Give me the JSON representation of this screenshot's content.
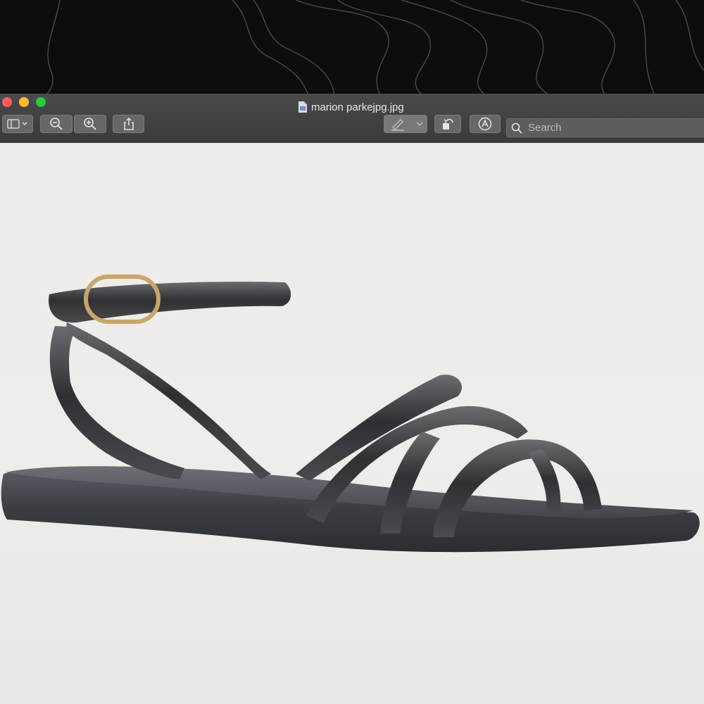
{
  "window": {
    "title": "marion parkejpg.jpg",
    "search_placeholder": "Search"
  },
  "toolbar": {
    "sidebar_icon": "sidebar-icon",
    "zoom_out_icon": "zoom-out-icon",
    "zoom_in_icon": "zoom-in-icon",
    "share_icon": "share-icon",
    "markup_icon": "pen-icon",
    "rotate_icon": "rotate-icon",
    "annotate_icon": "annotate-icon",
    "search_icon": "search-icon"
  },
  "colors": {
    "close": "#fe5f57",
    "minimize": "#febc2e",
    "maximize": "#28c840",
    "toolbar_bg": "#3e3e40",
    "content_bg": "#ecebe8"
  }
}
